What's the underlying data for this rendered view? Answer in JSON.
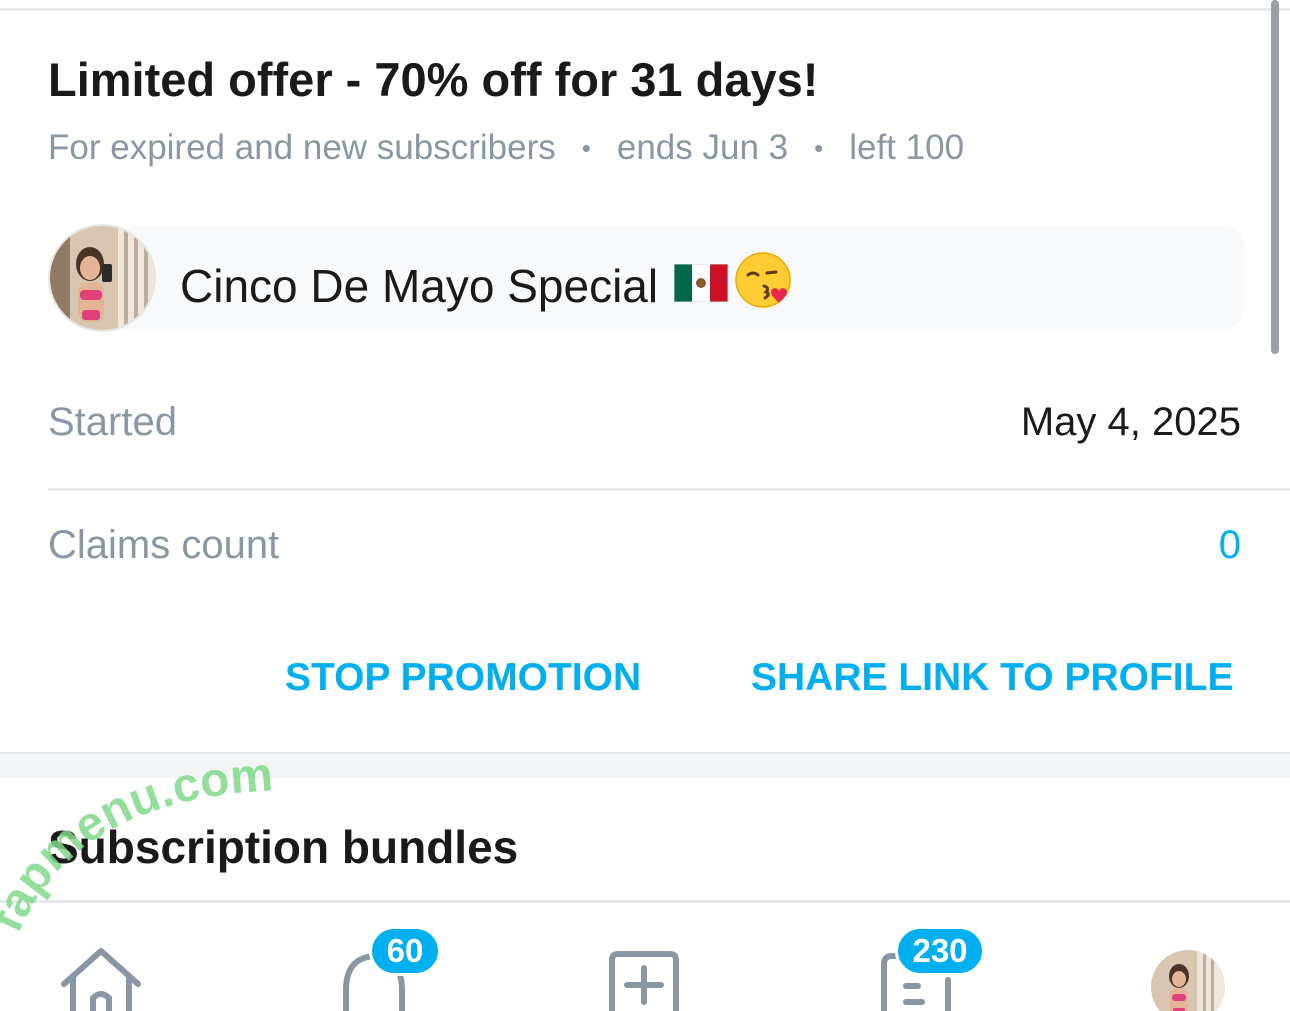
{
  "offer": {
    "title": "Limited offer - 70% off for 31 days!",
    "audience": "For expired and new subscribers",
    "separator": "•",
    "ends": "ends Jun 3",
    "left": "left 100"
  },
  "promo": {
    "message": "Cinco De Mayo Special"
  },
  "details": {
    "started_label": "Started",
    "started_value": "May 4, 2025",
    "claims_label": "Claims count",
    "claims_value": "0"
  },
  "actions": {
    "stop_label": "STOP PROMOTION",
    "share_label": "SHARE LINK TO PROFILE"
  },
  "section": {
    "bundles_title": "Subscription bundles"
  },
  "watermark": {
    "text": "fapmenu.com"
  },
  "bottom_nav": {
    "items": [
      {
        "icon": "home-icon"
      },
      {
        "icon": "bell-icon",
        "badge": "60"
      },
      {
        "icon": "add-post-icon"
      },
      {
        "icon": "messages-icon",
        "badge": "230"
      },
      {
        "icon": "profile-avatar"
      }
    ]
  },
  "colors": {
    "accent": "#00aff0",
    "muted_text": "#8a96a3",
    "divider": "#e4e8ea",
    "watermark": "#7fd88a"
  }
}
